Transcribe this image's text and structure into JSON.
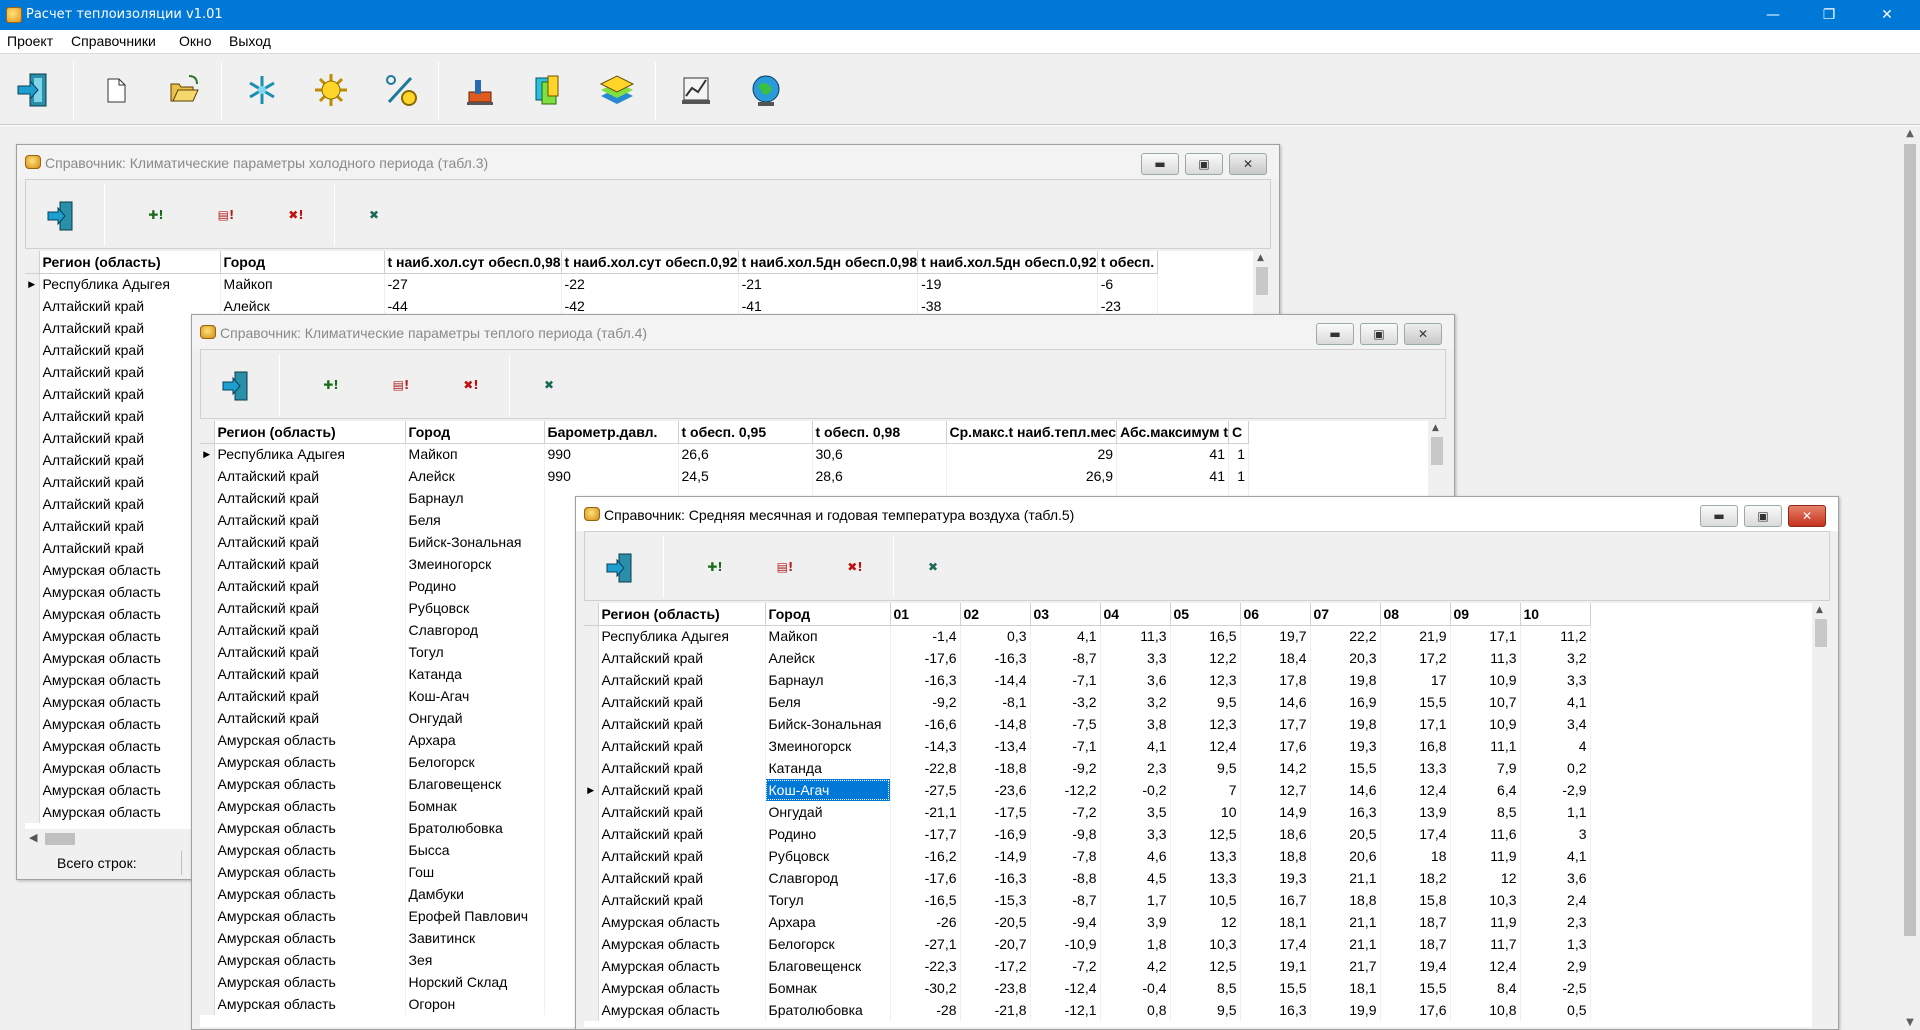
{
  "app": {
    "title": "Расчет теплоизоляции v1.01",
    "min": "—",
    "max": "❐",
    "close": "✕"
  },
  "menu": [
    "Проект",
    "Справочники",
    "Окно",
    "Выход"
  ],
  "toolbar_icons": [
    "exit-icon",
    "new-file-icon",
    "open-folder-icon",
    "snowflake-icon",
    "sun-icon",
    "percent-gear-icon",
    "pipe-icon",
    "materials-icon",
    "layers-icon",
    "report-icon",
    "globe-icon"
  ],
  "win_buttons": {
    "min": "▬",
    "max": "▣",
    "close": "✕"
  },
  "sub_toolbar": {
    "add": "✚!",
    "edit": "▤!",
    "del": "✖!",
    "excel": "✖"
  },
  "win1": {
    "title": "Справочник: Климатические параметры холодного периода (табл.3)",
    "headers": [
      "Регион (область)",
      "Город",
      "t наиб.хол.сут обесп.0,98",
      "t наиб.хол.сут обесп.0,92",
      "t наиб.хол.5дн обесп.0,98",
      "t наиб.хол.5дн обесп.0,92",
      "t обесп."
    ],
    "rows": [
      [
        "Республика Адыгея",
        "Майкоп",
        "-27",
        "-22",
        "-21",
        "-19",
        "-6"
      ],
      [
        "Алтайский край",
        "Алейск",
        "-44",
        "-42",
        "-41",
        "-38",
        "-23"
      ],
      [
        "Алтайский край",
        "",
        "",
        "",
        "",
        "",
        ""
      ],
      [
        "Алтайский край",
        "",
        "",
        "",
        "",
        "",
        ""
      ],
      [
        "Алтайский край",
        "",
        "",
        "",
        "",
        "",
        ""
      ],
      [
        "Алтайский край",
        "",
        "",
        "",
        "",
        "",
        ""
      ],
      [
        "Алтайский край",
        "",
        "",
        "",
        "",
        "",
        ""
      ],
      [
        "Алтайский край",
        "",
        "",
        "",
        "",
        "",
        ""
      ],
      [
        "Алтайский край",
        "",
        "",
        "",
        "",
        "",
        ""
      ],
      [
        "Алтайский край",
        "",
        "",
        "",
        "",
        "",
        ""
      ],
      [
        "Алтайский край",
        "",
        "",
        "",
        "",
        "",
        ""
      ],
      [
        "Алтайский край",
        "",
        "",
        "",
        "",
        "",
        ""
      ],
      [
        "Алтайский край",
        "",
        "",
        "",
        "",
        "",
        ""
      ],
      [
        "Амурская область",
        "",
        "",
        "",
        "",
        "",
        ""
      ],
      [
        "Амурская область",
        "",
        "",
        "",
        "",
        "",
        ""
      ],
      [
        "Амурская область",
        "",
        "",
        "",
        "",
        "",
        ""
      ],
      [
        "Амурская область",
        "",
        "",
        "",
        "",
        "",
        ""
      ],
      [
        "Амурская область",
        "",
        "",
        "",
        "",
        "",
        ""
      ],
      [
        "Амурская область",
        "",
        "",
        "",
        "",
        "",
        ""
      ],
      [
        "Амурская область",
        "",
        "",
        "",
        "",
        "",
        ""
      ],
      [
        "Амурская область",
        "",
        "",
        "",
        "",
        "",
        ""
      ],
      [
        "Амурская область",
        "",
        "",
        "",
        "",
        "",
        ""
      ],
      [
        "Амурская область",
        "",
        "",
        "",
        "",
        "",
        ""
      ],
      [
        "Амурская область",
        "",
        "",
        "",
        "",
        "",
        ""
      ],
      [
        "Амурская область",
        "",
        "",
        "",
        "",
        "",
        ""
      ]
    ],
    "status_label": "Всего строк:"
  },
  "win2": {
    "title": "Справочник: Климатические параметры теплого периода (табл.4)",
    "headers": [
      "Регион (область)",
      "Город",
      "Барометр.давл.",
      "t обесп. 0,95",
      "t обесп. 0,98",
      "Ср.макс.t наиб.тепл.мес",
      "Абс.максимум t",
      "С"
    ],
    "rows": [
      [
        "Республика Адыгея",
        "Майкоп",
        "990",
        "26,6",
        "30,6",
        "29",
        "41",
        "1"
      ],
      [
        "Алтайский край",
        "Алейск",
        "990",
        "24,5",
        "28,6",
        "26,9",
        "41",
        "1"
      ],
      [
        "Алтайский край",
        "Барнаул",
        "",
        "",
        "",
        "",
        "",
        ""
      ],
      [
        "Алтайский край",
        "Беля",
        "",
        "",
        "",
        "",
        "",
        ""
      ],
      [
        "Алтайский край",
        "Бийск-Зональная",
        "",
        "",
        "",
        "",
        "",
        ""
      ],
      [
        "Алтайский край",
        "Змеиногорск",
        "",
        "",
        "",
        "",
        "",
        ""
      ],
      [
        "Алтайский край",
        "Родино",
        "",
        "",
        "",
        "",
        "",
        ""
      ],
      [
        "Алтайский край",
        "Рубцовск",
        "",
        "",
        "",
        "",
        "",
        ""
      ],
      [
        "Алтайский край",
        "Славгород",
        "",
        "",
        "",
        "",
        "",
        ""
      ],
      [
        "Алтайский край",
        "Тогул",
        "",
        "",
        "",
        "",
        "",
        ""
      ],
      [
        "Алтайский край",
        "Катанда",
        "",
        "",
        "",
        "",
        "",
        ""
      ],
      [
        "Алтайский край",
        "Кош-Агач",
        "",
        "",
        "",
        "",
        "",
        ""
      ],
      [
        "Алтайский край",
        "Онгудай",
        "",
        "",
        "",
        "",
        "",
        ""
      ],
      [
        "Амурская область",
        "Архара",
        "",
        "",
        "",
        "",
        "",
        ""
      ],
      [
        "Амурская область",
        "Белогорск",
        "",
        "",
        "",
        "",
        "",
        ""
      ],
      [
        "Амурская область",
        "Благовещенск",
        "",
        "",
        "",
        "",
        "",
        ""
      ],
      [
        "Амурская область",
        "Бомнак",
        "",
        "",
        "",
        "",
        "",
        ""
      ],
      [
        "Амурская область",
        "Братолюбовка",
        "",
        "",
        "",
        "",
        "",
        ""
      ],
      [
        "Амурская область",
        "Бысса",
        "",
        "",
        "",
        "",
        "",
        ""
      ],
      [
        "Амурская область",
        "Гош",
        "",
        "",
        "",
        "",
        "",
        ""
      ],
      [
        "Амурская область",
        "Дамбуки",
        "",
        "",
        "",
        "",
        "",
        ""
      ],
      [
        "Амурская область",
        "Ерофей Павлович",
        "",
        "",
        "",
        "",
        "",
        ""
      ],
      [
        "Амурская область",
        "Завитинск",
        "",
        "",
        "",
        "",
        "",
        ""
      ],
      [
        "Амурская область",
        "Зея",
        "",
        "",
        "",
        "",
        "",
        ""
      ],
      [
        "Амурская область",
        "Норский Склад",
        "",
        "",
        "",
        "",
        "",
        ""
      ],
      [
        "Амурская область",
        "Огорон",
        "",
        "",
        "",
        "",
        "",
        ""
      ]
    ]
  },
  "win3": {
    "title": "Справочник: Средняя месячная и годовая температура воздуха (табл.5)",
    "headers": [
      "Регион (область)",
      "Город",
      "01",
      "02",
      "03",
      "04",
      "05",
      "06",
      "07",
      "08",
      "09",
      "10"
    ],
    "current_row": 7,
    "rows": [
      [
        "Республика Адыгея",
        "Майкоп",
        "-1,4",
        "0,3",
        "4,1",
        "11,3",
        "16,5",
        "19,7",
        "22,2",
        "21,9",
        "17,1",
        "11,2"
      ],
      [
        "Алтайский край",
        "Алейск",
        "-17,6",
        "-16,3",
        "-8,7",
        "3,3",
        "12,2",
        "18,4",
        "20,3",
        "17,2",
        "11,3",
        "3,2"
      ],
      [
        "Алтайский край",
        "Барнаул",
        "-16,3",
        "-14,4",
        "-7,1",
        "3,6",
        "12,3",
        "17,8",
        "19,8",
        "17",
        "10,9",
        "3,3"
      ],
      [
        "Алтайский край",
        "Беля",
        "-9,2",
        "-8,1",
        "-3,2",
        "3,2",
        "9,5",
        "14,6",
        "16,9",
        "15,5",
        "10,7",
        "4,1"
      ],
      [
        "Алтайский край",
        "Бийск-Зональная",
        "-16,6",
        "-14,8",
        "-7,5",
        "3,8",
        "12,3",
        "17,7",
        "19,8",
        "17,1",
        "10,9",
        "3,4"
      ],
      [
        "Алтайский край",
        "Змеиногорск",
        "-14,3",
        "-13,4",
        "-7,1",
        "4,1",
        "12,4",
        "17,6",
        "19,3",
        "16,8",
        "11,1",
        "4"
      ],
      [
        "Алтайский край",
        "Катанда",
        "-22,8",
        "-18,8",
        "-9,2",
        "2,3",
        "9,5",
        "14,2",
        "15,5",
        "13,3",
        "7,9",
        "0,2"
      ],
      [
        "Алтайский край",
        "Кош-Агач",
        "-27,5",
        "-23,6",
        "-12,2",
        "-0,2",
        "7",
        "12,7",
        "14,6",
        "12,4",
        "6,4",
        "-2,9"
      ],
      [
        "Алтайский край",
        "Онгудай",
        "-21,1",
        "-17,5",
        "-7,2",
        "3,5",
        "10",
        "14,9",
        "16,3",
        "13,9",
        "8,5",
        "1,1"
      ],
      [
        "Алтайский край",
        "Родино",
        "-17,7",
        "-16,9",
        "-9,8",
        "3,3",
        "12,5",
        "18,6",
        "20,5",
        "17,4",
        "11,6",
        "3"
      ],
      [
        "Алтайский край",
        "Рубцовск",
        "-16,2",
        "-14,9",
        "-7,8",
        "4,6",
        "13,3",
        "18,8",
        "20,6",
        "18",
        "11,9",
        "4,1"
      ],
      [
        "Алтайский край",
        "Славгород",
        "-17,6",
        "-16,3",
        "-8,8",
        "4,5",
        "13,3",
        "19,3",
        "21,1",
        "18,2",
        "12",
        "3,6"
      ],
      [
        "Алтайский край",
        "Тогул",
        "-16,5",
        "-15,3",
        "-8,7",
        "1,7",
        "10,5",
        "16,7",
        "18,8",
        "15,8",
        "10,3",
        "2,4"
      ],
      [
        "Амурская область",
        "Архара",
        "-26",
        "-20,5",
        "-9,4",
        "3,9",
        "12",
        "18,1",
        "21,1",
        "18,7",
        "11,9",
        "2,3"
      ],
      [
        "Амурская область",
        "Белогорск",
        "-27,1",
        "-20,7",
        "-10,9",
        "1,8",
        "10,3",
        "17,4",
        "21,1",
        "18,7",
        "11,7",
        "1,3"
      ],
      [
        "Амурская область",
        "Благовещенск",
        "-22,3",
        "-17,2",
        "-7,2",
        "4,2",
        "12,5",
        "19,1",
        "21,7",
        "19,4",
        "12,4",
        "2,9"
      ],
      [
        "Амурская область",
        "Бомнак",
        "-30,2",
        "-23,8",
        "-12,4",
        "-0,4",
        "8,5",
        "15,5",
        "18,1",
        "15,5",
        "8,4",
        "-2,5"
      ],
      [
        "Амурская область",
        "Братолюбовка",
        "-28",
        "-21,8",
        "-12,1",
        "0,8",
        "9,5",
        "16,3",
        "19,9",
        "17,6",
        "10,8",
        "0,5"
      ]
    ]
  }
}
